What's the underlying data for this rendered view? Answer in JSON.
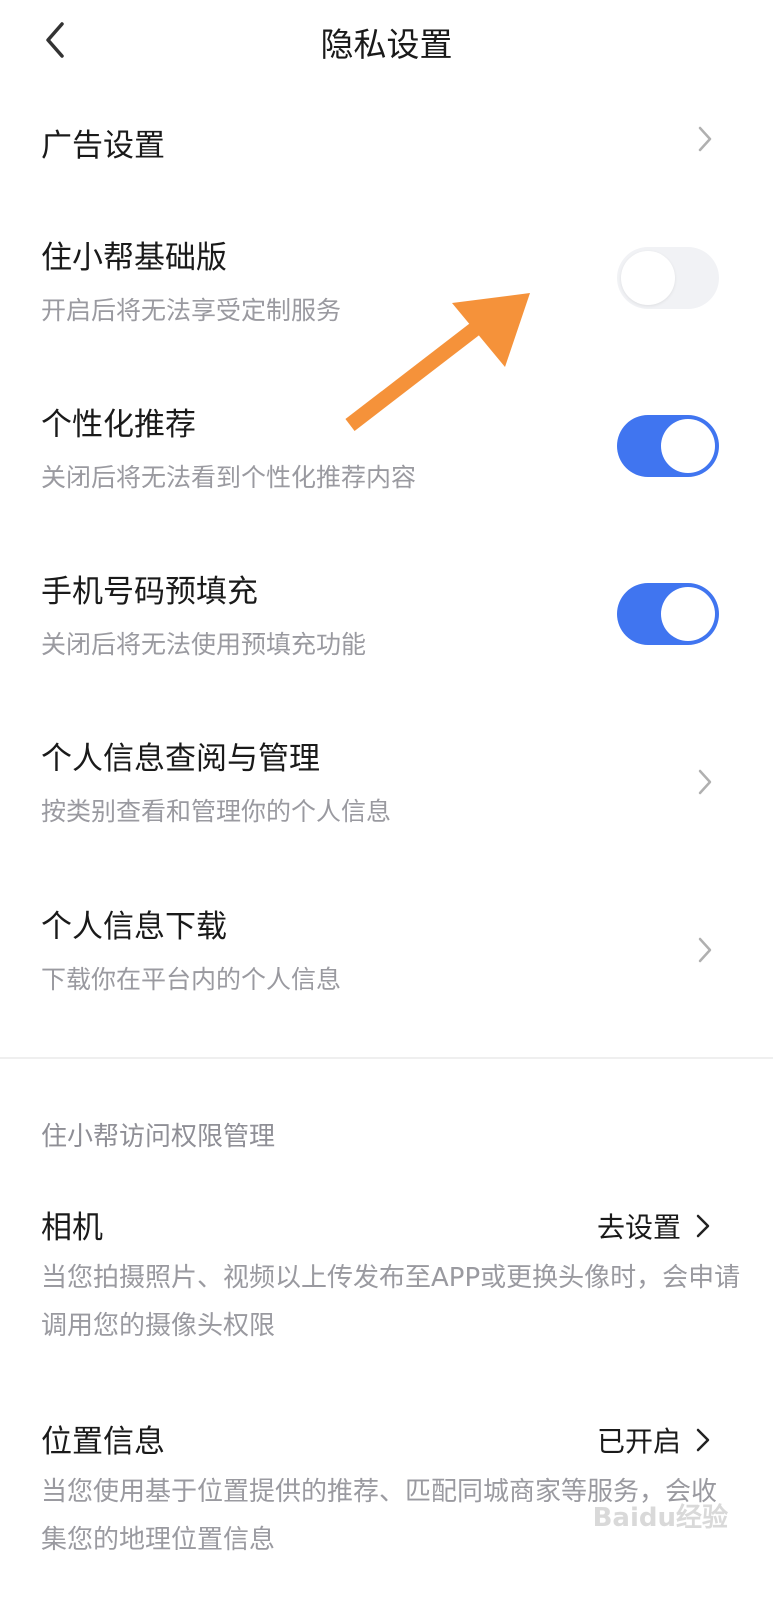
{
  "header": {
    "title": "隐私设置",
    "back_icon": "chevron-left-icon"
  },
  "settings": [
    {
      "label": "广告设置",
      "control": "chevron"
    },
    {
      "label": "住小帮基础版",
      "subtitle": "开启后将无法享受定制服务",
      "control": "toggle",
      "enabled": false
    },
    {
      "label": "个性化推荐",
      "subtitle": "关闭后将无法看到个性化推荐内容",
      "control": "toggle",
      "enabled": true
    },
    {
      "label": "手机号码预填充",
      "subtitle": "关闭后将无法使用预填充功能",
      "control": "toggle",
      "enabled": true
    },
    {
      "label": "个人信息查阅与管理",
      "subtitle": "按类别查看和管理你的个人信息",
      "control": "chevron"
    },
    {
      "label": "个人信息下载",
      "subtitle": "下载你在平台内的个人信息",
      "control": "chevron"
    }
  ],
  "permissions": {
    "section_title": "住小帮访问权限管理",
    "items": [
      {
        "label": "相机",
        "action": "去设置",
        "description": "当您拍摄照片、视频以上传发布至APP或更换头像时，会申请调用您的摄像头权限"
      },
      {
        "label": "位置信息",
        "action": "已开启",
        "description": "当您使用基于位置提供的推荐、匹配同城商家等服务，会收集您的地理位置信息"
      }
    ]
  },
  "annotation": {
    "color": "#f5923a"
  },
  "colors": {
    "toggle_on": "#4075f0",
    "toggle_off": "#f1f2f5",
    "subtitle": "#9a9aa0"
  },
  "watermark": "Baidu经验"
}
